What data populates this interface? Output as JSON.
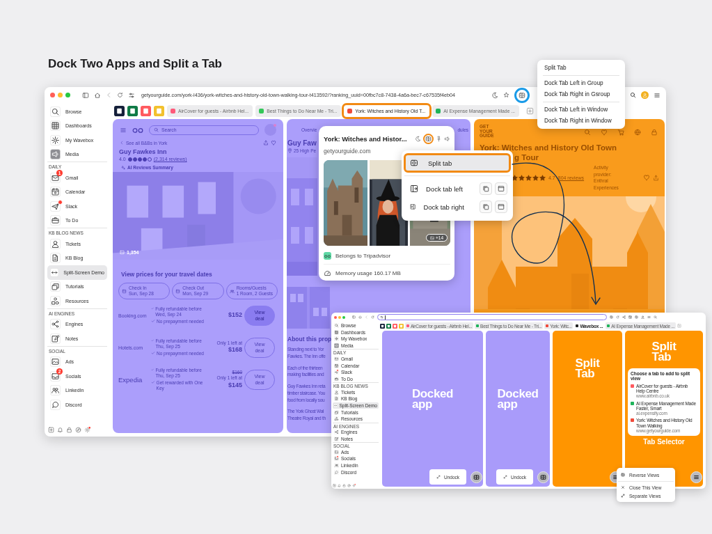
{
  "heading": "Dock Two Apps and Split a Tab",
  "browser": {
    "url": "getyourguide.com/york-l436/york-witches-and-history-old-town-walking-tour-t413592/?ranking_uuid=00fbc7c8-7438-4a6a-bec7-c67535f4eb04",
    "split_button_circled": true,
    "sidebar": [
      {
        "kind": "item",
        "label": "Browse",
        "selected": false,
        "active": false,
        "dot": false
      },
      {
        "kind": "item",
        "label": "Dashboards",
        "selected": false,
        "active": false,
        "dot": false
      },
      {
        "kind": "item",
        "label": "My Wavebox",
        "selected": false,
        "active": false,
        "dot": false
      },
      {
        "kind": "item",
        "label": "Media",
        "selected": false,
        "active": true,
        "dot": false
      },
      {
        "kind": "header",
        "label": "DAILY"
      },
      {
        "kind": "item",
        "label": "Gmail",
        "selected": false,
        "active": false,
        "dot": false,
        "badge": "1"
      },
      {
        "kind": "item",
        "label": "Calendar",
        "selected": false,
        "active": false,
        "dot": false
      },
      {
        "kind": "item",
        "label": "Slack",
        "selected": false,
        "active": false,
        "dot": true
      },
      {
        "kind": "item",
        "label": "To Do",
        "selected": false,
        "active": false,
        "dot": false
      },
      {
        "kind": "header",
        "label": "KB BLOG NEWS"
      },
      {
        "kind": "item",
        "label": "Tickets",
        "selected": false,
        "active": false,
        "dot": false
      },
      {
        "kind": "item",
        "label": "KB Blog",
        "selected": false,
        "active": false,
        "dot": false
      },
      {
        "kind": "item",
        "label": "Split-Screen Demo",
        "selected": true,
        "active": false,
        "dot": false
      },
      {
        "kind": "item",
        "label": "Tutorials",
        "selected": false,
        "active": false,
        "dot": false
      },
      {
        "kind": "item",
        "label": "Resources",
        "selected": false,
        "active": false,
        "dot": false
      },
      {
        "kind": "header",
        "label": "AI ENGINES"
      },
      {
        "kind": "item",
        "label": "Engines",
        "selected": false,
        "active": false,
        "dot": false
      },
      {
        "kind": "item",
        "label": "Notes",
        "selected": false,
        "active": false,
        "dot": false
      },
      {
        "kind": "header",
        "label": "SOCIAL"
      },
      {
        "kind": "item",
        "label": "Ads",
        "selected": false,
        "active": false,
        "dot": false
      },
      {
        "kind": "item",
        "label": "Socials",
        "selected": false,
        "active": false,
        "dot": false,
        "badge": "2"
      },
      {
        "kind": "item",
        "label": "LinkedIn",
        "selected": false,
        "active": false,
        "dot": false
      },
      {
        "kind": "item",
        "label": "Discord",
        "selected": false,
        "active": false,
        "dot": false
      }
    ],
    "pinned_tabs": [
      {
        "color": "#15203a"
      },
      {
        "color": "#0f7a46"
      },
      {
        "color": "#ff5a5f"
      },
      {
        "color": "#f2c12e"
      }
    ],
    "tabs": [
      {
        "label": "AirCover for guests - Airbnb Hel...",
        "color": "#ff5a7a",
        "selected": false,
        "highlighted": false
      },
      {
        "label": "Best Things to Do Near Me - Tri...",
        "color": "#34c759",
        "selected": false,
        "highlighted": false
      },
      {
        "label": "York: Witches and History Old T...",
        "color": "#f04a3a",
        "selected": true,
        "highlighted": true
      },
      {
        "label": "AI Expense Management Made ...",
        "color": "#1fb35a",
        "selected": false,
        "highlighted": false
      }
    ],
    "tripadvisor": {
      "search_placeholder": "Search",
      "back_link": "See all B&Bs in York",
      "name": "Guy Fawkes Inn",
      "rating": "4.0",
      "stars": 4,
      "reviews": "(2,314 reviews)",
      "ai_summary": "AI Reviews Summary",
      "photo_count": "1,354",
      "prices_heading": "View prices for your travel dates",
      "chips": [
        {
          "label": "Check In",
          "value": "Sun, Sep 28"
        },
        {
          "label": "Check Out",
          "value": "Mon, Sep 29"
        },
        {
          "label": "Rooms/Guests",
          "value": "1 Room, 2 Guests"
        }
      ],
      "deals": [
        {
          "provider": "Booking.com",
          "features": [
            "Fully refundable before Wed, Sep 24",
            "No prepayment needed"
          ],
          "price": "$152",
          "button": "View deal",
          "primary": true
        },
        {
          "provider": "Hotels.com",
          "features": [
            "Fully refundable before Thu, Sep 25",
            "No prepayment needed"
          ],
          "note": "Only 1 left at",
          "price": "$168",
          "button": "View deal",
          "primary": false
        },
        {
          "provider": "Expedia",
          "features": [
            "Fully refundable before Thu, Sep 25",
            "Get rewarded with One Key"
          ],
          "was": "$160",
          "note": "Only 1 left at",
          "price": "$145",
          "button": "View deal",
          "primary": false
        }
      ]
    },
    "middle": {
      "tab": "Overvie",
      "tab_end": "dules",
      "title": "Guy Faw",
      "address": "25 High Pe",
      "section": "About this prop",
      "paragraphs": [
        [
          "Standing next to Yor",
          "Fawkes. The Inn offe"
        ],
        [
          "Each of the thirteen",
          "making facilities and"
        ],
        [
          "Guy Fawkes Inn reta",
          "timber staircase. You",
          "food from locally sou"
        ],
        [
          "The York Ghost Wal",
          "Theatre Royal and th"
        ]
      ]
    },
    "getyourguide": {
      "logo": "GET YOUR GUIDE",
      "title": "York: Witches and History Old Town",
      "title_end": "g Tour",
      "stars": 5,
      "rating": "4.7",
      "reviews": "804 reviews",
      "provider": "Activity provider: Enthral Experiences"
    }
  },
  "tab_preview": {
    "title": "York: Witches and Histor...",
    "domain": "getyourguide.com",
    "split_icon_circled": true,
    "photo_more": "+14",
    "owner": "Belongs to Tripadvisor",
    "memory": "Memory usage 160.17 MB"
  },
  "tab_menu": [
    {
      "kind": "split",
      "label": "Split tab",
      "highlighted": true
    },
    {
      "kind": "dock",
      "label": "Dock tab left",
      "highlighted": false
    },
    {
      "kind": "dock",
      "label": "Dock tab right",
      "highlighted": false
    }
  ],
  "split_menu": [
    [
      "Split Tab"
    ],
    [
      "Dock Tab Left in Group",
      "Dock Tab Right in Gsroup"
    ],
    [
      "Dock Tab Left in Window",
      "Dock Tab Right in Window"
    ]
  ],
  "inset": {
    "sidebar": [
      {
        "kind": "item",
        "label": "Browse",
        "selected": false,
        "active": false,
        "dot": false
      },
      {
        "kind": "item",
        "label": "Dashboards",
        "selected": false,
        "active": false,
        "dot": false
      },
      {
        "kind": "item",
        "label": "My Wavebox",
        "selected": false,
        "active": false,
        "dot": false
      },
      {
        "kind": "item",
        "label": "Media",
        "selected": false,
        "active": true,
        "dot": false
      },
      {
        "kind": "header",
        "label": "DAILY"
      },
      {
        "kind": "item",
        "label": "Gmail",
        "selected": false,
        "active": false,
        "dot": false
      },
      {
        "kind": "item",
        "label": "Calendar",
        "selected": false,
        "active": false,
        "dot": false
      },
      {
        "kind": "item",
        "label": "Slack",
        "selected": false,
        "active": false,
        "dot": true
      },
      {
        "kind": "item",
        "label": "To Do",
        "selected": false,
        "active": false,
        "dot": false
      },
      {
        "kind": "header",
        "label": "KB BLOG NEWS"
      },
      {
        "kind": "item",
        "label": "Tickets",
        "selected": false,
        "active": false,
        "dot": false
      },
      {
        "kind": "item",
        "label": "KB Blog",
        "selected": false,
        "active": false,
        "dot": false
      },
      {
        "kind": "item",
        "label": "Split-Screen Demo",
        "selected": true,
        "active": false,
        "dot": false
      },
      {
        "kind": "item",
        "label": "Tutorials",
        "selected": false,
        "active": false,
        "dot": false
      },
      {
        "kind": "item",
        "label": "Resources",
        "selected": false,
        "active": false,
        "dot": false
      },
      {
        "kind": "header",
        "label": "AI ENGINES"
      },
      {
        "kind": "item",
        "label": "Engines",
        "selected": false,
        "active": false,
        "dot": false
      },
      {
        "kind": "item",
        "label": "Notes",
        "selected": false,
        "active": false,
        "dot": false
      },
      {
        "kind": "header",
        "label": "SOCIAL"
      },
      {
        "kind": "item",
        "label": "Ads",
        "selected": false,
        "active": false,
        "dot": false
      },
      {
        "kind": "item",
        "label": "Socials",
        "selected": false,
        "active": false,
        "dot": true
      },
      {
        "kind": "item",
        "label": "LinkedIn",
        "selected": false,
        "active": false,
        "dot": false
      },
      {
        "kind": "item",
        "label": "Discord",
        "selected": false,
        "active": false,
        "dot": false
      }
    ],
    "tabs": [
      {
        "label": "AirCover for guests - Airbnb Hel...",
        "color": "#ff5a7a",
        "selected": false
      },
      {
        "label": "Best Things to Do Near Me - Tri...",
        "color": "#1fb35a",
        "selected": false
      },
      {
        "label": "York: Witc...",
        "color": "#f04a3a",
        "selected": false
      },
      {
        "label": "Wavebox ...",
        "color": "#222222",
        "selected": true
      },
      {
        "label": "AI Expense Management Made ...",
        "color": "#1fb35a",
        "selected": false
      }
    ],
    "panels": [
      {
        "kind": "docked",
        "label": "Docked app",
        "button": "Undock"
      },
      {
        "kind": "docked",
        "label": "Docked app",
        "button": "Undock"
      },
      {
        "kind": "split",
        "label": "Split Tab"
      },
      {
        "kind": "selector",
        "label": "Split Tab",
        "selector_title": "Choose a tab to add to split view",
        "caption": "Tab Selector",
        "options": [
          {
            "title": "AirCover for guests - Airbnb Help Centre",
            "url": "www.airbnb.co.uk",
            "color": "#ff5a5f"
          },
          {
            "title": "AI Expense Management Made Faster, Smart",
            "url": "ai.expensify.com",
            "color": "#1fb35a"
          },
          {
            "title": "York: Witches and History Old Town Walking",
            "url": "www.getyourguide.com",
            "color": "#f04a3a"
          }
        ]
      }
    ],
    "menu": [
      {
        "kind": "reverse",
        "label": "Reverse Views"
      },
      {
        "kind": "close",
        "label": "Close This View"
      },
      {
        "kind": "separate",
        "label": "Separate Views"
      }
    ]
  }
}
